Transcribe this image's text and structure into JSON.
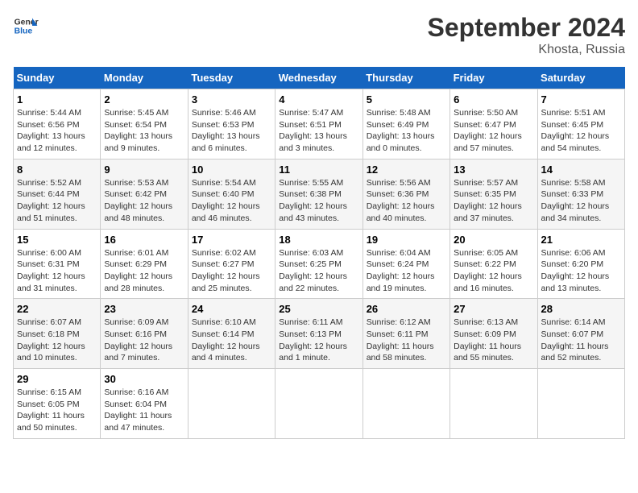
{
  "header": {
    "logo_line1": "General",
    "logo_line2": "Blue",
    "month": "September 2024",
    "location": "Khosta, Russia"
  },
  "columns": [
    "Sunday",
    "Monday",
    "Tuesday",
    "Wednesday",
    "Thursday",
    "Friday",
    "Saturday"
  ],
  "weeks": [
    [
      {
        "day": "1",
        "info": "Sunrise: 5:44 AM\nSunset: 6:56 PM\nDaylight: 13 hours and 12 minutes."
      },
      {
        "day": "2",
        "info": "Sunrise: 5:45 AM\nSunset: 6:54 PM\nDaylight: 13 hours and 9 minutes."
      },
      {
        "day": "3",
        "info": "Sunrise: 5:46 AM\nSunset: 6:53 PM\nDaylight: 13 hours and 6 minutes."
      },
      {
        "day": "4",
        "info": "Sunrise: 5:47 AM\nSunset: 6:51 PM\nDaylight: 13 hours and 3 minutes."
      },
      {
        "day": "5",
        "info": "Sunrise: 5:48 AM\nSunset: 6:49 PM\nDaylight: 13 hours and 0 minutes."
      },
      {
        "day": "6",
        "info": "Sunrise: 5:50 AM\nSunset: 6:47 PM\nDaylight: 12 hours and 57 minutes."
      },
      {
        "day": "7",
        "info": "Sunrise: 5:51 AM\nSunset: 6:45 PM\nDaylight: 12 hours and 54 minutes."
      }
    ],
    [
      {
        "day": "8",
        "info": "Sunrise: 5:52 AM\nSunset: 6:44 PM\nDaylight: 12 hours and 51 minutes."
      },
      {
        "day": "9",
        "info": "Sunrise: 5:53 AM\nSunset: 6:42 PM\nDaylight: 12 hours and 48 minutes."
      },
      {
        "day": "10",
        "info": "Sunrise: 5:54 AM\nSunset: 6:40 PM\nDaylight: 12 hours and 46 minutes."
      },
      {
        "day": "11",
        "info": "Sunrise: 5:55 AM\nSunset: 6:38 PM\nDaylight: 12 hours and 43 minutes."
      },
      {
        "day": "12",
        "info": "Sunrise: 5:56 AM\nSunset: 6:36 PM\nDaylight: 12 hours and 40 minutes."
      },
      {
        "day": "13",
        "info": "Sunrise: 5:57 AM\nSunset: 6:35 PM\nDaylight: 12 hours and 37 minutes."
      },
      {
        "day": "14",
        "info": "Sunrise: 5:58 AM\nSunset: 6:33 PM\nDaylight: 12 hours and 34 minutes."
      }
    ],
    [
      {
        "day": "15",
        "info": "Sunrise: 6:00 AM\nSunset: 6:31 PM\nDaylight: 12 hours and 31 minutes."
      },
      {
        "day": "16",
        "info": "Sunrise: 6:01 AM\nSunset: 6:29 PM\nDaylight: 12 hours and 28 minutes."
      },
      {
        "day": "17",
        "info": "Sunrise: 6:02 AM\nSunset: 6:27 PM\nDaylight: 12 hours and 25 minutes."
      },
      {
        "day": "18",
        "info": "Sunrise: 6:03 AM\nSunset: 6:25 PM\nDaylight: 12 hours and 22 minutes."
      },
      {
        "day": "19",
        "info": "Sunrise: 6:04 AM\nSunset: 6:24 PM\nDaylight: 12 hours and 19 minutes."
      },
      {
        "day": "20",
        "info": "Sunrise: 6:05 AM\nSunset: 6:22 PM\nDaylight: 12 hours and 16 minutes."
      },
      {
        "day": "21",
        "info": "Sunrise: 6:06 AM\nSunset: 6:20 PM\nDaylight: 12 hours and 13 minutes."
      }
    ],
    [
      {
        "day": "22",
        "info": "Sunrise: 6:07 AM\nSunset: 6:18 PM\nDaylight: 12 hours and 10 minutes."
      },
      {
        "day": "23",
        "info": "Sunrise: 6:09 AM\nSunset: 6:16 PM\nDaylight: 12 hours and 7 minutes."
      },
      {
        "day": "24",
        "info": "Sunrise: 6:10 AM\nSunset: 6:14 PM\nDaylight: 12 hours and 4 minutes."
      },
      {
        "day": "25",
        "info": "Sunrise: 6:11 AM\nSunset: 6:13 PM\nDaylight: 12 hours and 1 minute."
      },
      {
        "day": "26",
        "info": "Sunrise: 6:12 AM\nSunset: 6:11 PM\nDaylight: 11 hours and 58 minutes."
      },
      {
        "day": "27",
        "info": "Sunrise: 6:13 AM\nSunset: 6:09 PM\nDaylight: 11 hours and 55 minutes."
      },
      {
        "day": "28",
        "info": "Sunrise: 6:14 AM\nSunset: 6:07 PM\nDaylight: 11 hours and 52 minutes."
      }
    ],
    [
      {
        "day": "29",
        "info": "Sunrise: 6:15 AM\nSunset: 6:05 PM\nDaylight: 11 hours and 50 minutes."
      },
      {
        "day": "30",
        "info": "Sunrise: 6:16 AM\nSunset: 6:04 PM\nDaylight: 11 hours and 47 minutes."
      },
      null,
      null,
      null,
      null,
      null
    ]
  ]
}
